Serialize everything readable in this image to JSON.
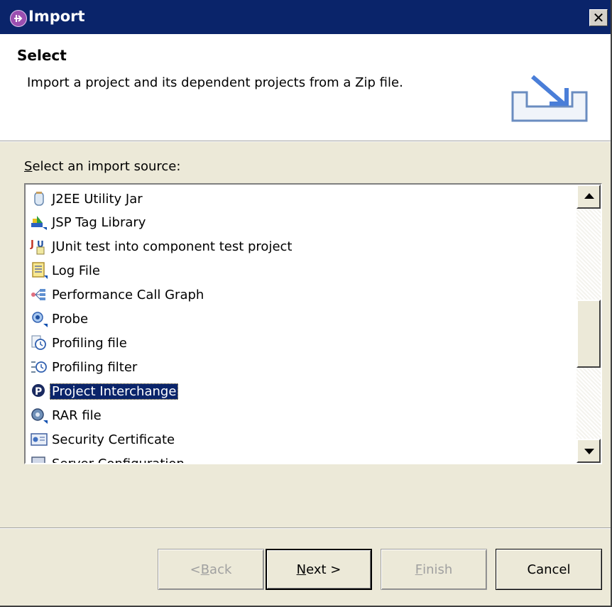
{
  "window": {
    "title": "Import",
    "close_glyph": "✕"
  },
  "header": {
    "heading": "Select",
    "description": "Import a project and its dependent projects from a Zip file."
  },
  "source_label": {
    "mnemonic": "S",
    "rest": "elect an import source:"
  },
  "list": {
    "items": [
      {
        "label": "J2EE Utility Jar",
        "icon": "jar-icon",
        "selected": false
      },
      {
        "label": "JSP Tag Library",
        "icon": "tag-library-icon",
        "selected": false
      },
      {
        "label": "JUnit test into component test project",
        "icon": "junit-icon",
        "selected": false
      },
      {
        "label": "Log File",
        "icon": "log-file-icon",
        "selected": false
      },
      {
        "label": "Performance Call Graph",
        "icon": "call-graph-icon",
        "selected": false
      },
      {
        "label": "Probe",
        "icon": "probe-icon",
        "selected": false
      },
      {
        "label": "Profiling file",
        "icon": "profiling-file-icon",
        "selected": false
      },
      {
        "label": "Profiling filter",
        "icon": "profiling-filter-icon",
        "selected": false
      },
      {
        "label": "Project Interchange",
        "icon": "project-interchange-icon",
        "selected": true
      },
      {
        "label": "RAR file",
        "icon": "rar-file-icon",
        "selected": false
      },
      {
        "label": "Security Certificate",
        "icon": "security-certificate-icon",
        "selected": false
      },
      {
        "label": "Server Configuration",
        "icon": "server-config-icon",
        "selected": false
      }
    ]
  },
  "buttons": {
    "back": {
      "pre": "< ",
      "mnemonic": "B",
      "rest": "ack"
    },
    "next": {
      "mnemonic": "N",
      "rest": "ext >"
    },
    "finish": {
      "mnemonic": "F",
      "rest": "inish"
    },
    "cancel": "Cancel"
  },
  "colors": {
    "title_bar": "#0a246a",
    "selection": "#0a246a",
    "dialog_bg": "#ece9d8"
  }
}
